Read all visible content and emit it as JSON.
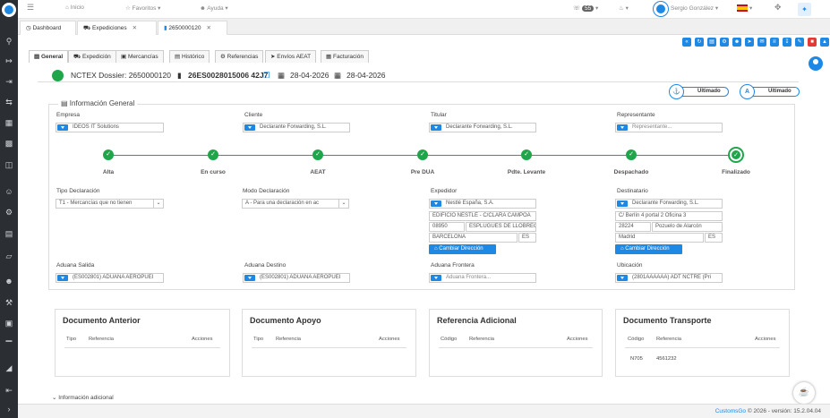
{
  "topbar": {
    "inicio": "Inicio",
    "favoritos": "Favoritos",
    "ayuda": "Ayuda",
    "notif_count": "55",
    "user": "Sergio González"
  },
  "window_tabs": [
    {
      "label": "Dashboard"
    },
    {
      "label": "Expediciones"
    },
    {
      "label": "2650000120"
    }
  ],
  "page_tabs": [
    "General",
    "Expedición",
    "Mercancías",
    "Histórico",
    "Referencias",
    "Envíos AEAT",
    "Facturación"
  ],
  "header": {
    "title": "NCTEX Dossier: 2650000120",
    "mrn": "26ES00280150064 2J7",
    "mrn_display": "26ES0028015006 42J7",
    "date1": "28-04-2026",
    "date2": "28-04-2026"
  },
  "ultimado": {
    "label1": "Ultimado",
    "label2": "Ultimado"
  },
  "info": {
    "section_title": "Información General",
    "empresa_label": "Empresa",
    "empresa_value": "IDEOS IT Solutions",
    "cliente_label": "Cliente",
    "cliente_value": "Declarante Forwarding, S.L.",
    "titular_label": "Titular",
    "titular_value": "Declarante Forwarding, S.L.",
    "representante_label": "Representante",
    "representante_placeholder": "Representante..."
  },
  "steps": [
    "Alta",
    "En curso",
    "AEAT",
    "Pre DUA",
    "Pdte. Levante",
    "Despachado",
    "Finalizado"
  ],
  "tipo_decl": {
    "label": "Tipo Declaración",
    "value": "T1 - Mercancías que no tienen"
  },
  "modo_decl": {
    "label": "Modo Declaración",
    "value": "A - Para una declaración en ac"
  },
  "expedidor": {
    "label": "Expedidor",
    "name": "Nestlé España, S.A.",
    "address": "EDIFICIO NESTLÉ - C/CLARA CAMPOA",
    "zip": "08950",
    "city": "ESPLUGUES DE LLOBREG",
    "province": "BARCELONA",
    "country": "ES",
    "button": "Cambiar Dirección"
  },
  "destinatario": {
    "label": "Destinatario",
    "name": "Declarante Forwarding, S.L.",
    "address": "C/ Berlín 4 portal 2 Oficina 3",
    "zip": "28224",
    "city": "Pozuelo de Alarcón",
    "province": "Madrid",
    "country": "ES",
    "button": "Cambiar Dirección"
  },
  "aduana_salida": {
    "label": "Aduana Salida",
    "value": "(ES002801) ADUANA AEROPUEI"
  },
  "aduana_destino": {
    "label": "Aduana Destino",
    "value": "(ES002801) ADUANA AEROPUEI"
  },
  "aduana_frontera": {
    "label": "Aduana Frontera",
    "placeholder": "Aduana Frontera..."
  },
  "ubicacion": {
    "label": "Ubicación",
    "value": "(2801AAAAAA) ADT NCTRE (Pri"
  },
  "cards": [
    {
      "title": "Documento Anterior",
      "cols": [
        "Tipo",
        "Referencia",
        "Acciones"
      ]
    },
    {
      "title": "Documento Apoyo",
      "cols": [
        "Tipo",
        "Referencia",
        "Acciones"
      ]
    },
    {
      "title": "Referencia Adicional",
      "cols": [
        "Código",
        "Referencia",
        "Acciones"
      ]
    },
    {
      "title": "Documento Transporte",
      "cols": [
        "Código",
        "Referencia",
        "Acciones"
      ],
      "rows": [
        [
          "N705",
          "4561232"
        ]
      ]
    }
  ],
  "info_adicional": "Información adicional",
  "footer": {
    "brand": "CustomsGo",
    "text": "© 2026 - versión: 15.2.04.04"
  }
}
